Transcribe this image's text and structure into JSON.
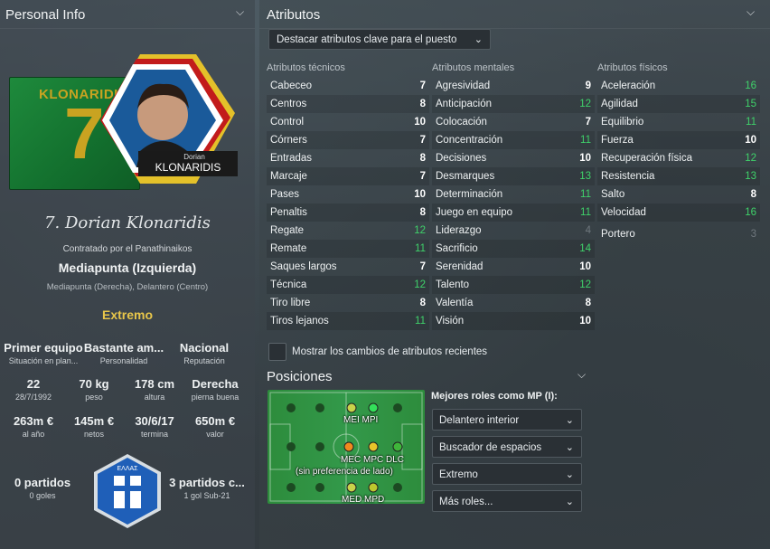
{
  "personal": {
    "title": "Personal Info",
    "card_name": "KLONARIDIS",
    "card_number": "7",
    "badge_first": "Dorian",
    "badge_last": "KLONARIDIS",
    "signature": "7. Dorian Klonaridis",
    "signed_by": "Contratado por el Panathinaikos",
    "position": "Mediapunta (Izquierda)",
    "alt_positions": "Mediapunta (Derecha), Delantero (Centro)",
    "role": "Extremo",
    "stats": [
      {
        "value": "Primer equipo",
        "label": "Situación en plan..."
      },
      {
        "value": "Bastante am...",
        "label": "Personalidad"
      },
      {
        "value": "Nacional",
        "label": "Reputación"
      },
      {
        "value": "22",
        "label": "28/7/1992"
      },
      {
        "value": "70 kg",
        "label": "peso"
      },
      {
        "value": "178 cm",
        "label": "altura"
      },
      {
        "value": "Derecha",
        "label": "pierna buena"
      },
      {
        "value": "263m €",
        "label": "al año"
      },
      {
        "value": "145m €",
        "label": "netos"
      },
      {
        "value": "30/6/17",
        "label": "termina"
      },
      {
        "value": "650m €",
        "label": "valor"
      }
    ],
    "left_apps": {
      "value": "0 partidos",
      "label": "0 goles"
    },
    "right_apps": {
      "value": "3 partidos c...",
      "label": "1 gol Sub-21"
    },
    "flag_text": "ΕΛΛΑΣ"
  },
  "attributes": {
    "title": "Atributos",
    "highlight_dropdown": "Destacar atributos clave para el puesto",
    "technical_header": "Atributos técnicos",
    "mental_header": "Atributos mentales",
    "physical_header": "Atributos físicos",
    "technical": [
      {
        "name": "Cabeceo",
        "value": "7"
      },
      {
        "name": "Centros",
        "value": "8"
      },
      {
        "name": "Control",
        "value": "10"
      },
      {
        "name": "Córners",
        "value": "7"
      },
      {
        "name": "Entradas",
        "value": "8"
      },
      {
        "name": "Marcaje",
        "value": "7"
      },
      {
        "name": "Pases",
        "value": "10"
      },
      {
        "name": "Penaltis",
        "value": "8"
      },
      {
        "name": "Regate",
        "value": "12"
      },
      {
        "name": "Remate",
        "value": "11"
      },
      {
        "name": "Saques largos",
        "value": "7"
      },
      {
        "name": "Técnica",
        "value": "12"
      },
      {
        "name": "Tiro libre",
        "value": "8"
      },
      {
        "name": "Tiros lejanos",
        "value": "11"
      }
    ],
    "mental": [
      {
        "name": "Agresividad",
        "value": "9"
      },
      {
        "name": "Anticipación",
        "value": "12"
      },
      {
        "name": "Colocación",
        "value": "7"
      },
      {
        "name": "Concentración",
        "value": "11"
      },
      {
        "name": "Decisiones",
        "value": "10"
      },
      {
        "name": "Desmarques",
        "value": "13"
      },
      {
        "name": "Determinación",
        "value": "11"
      },
      {
        "name": "Juego en equipo",
        "value": "11"
      },
      {
        "name": "Liderazgo",
        "value": "4"
      },
      {
        "name": "Sacrificio",
        "value": "14"
      },
      {
        "name": "Serenidad",
        "value": "10"
      },
      {
        "name": "Talento",
        "value": "12"
      },
      {
        "name": "Valentía",
        "value": "8"
      },
      {
        "name": "Visión",
        "value": "10"
      }
    ],
    "physical": [
      {
        "name": "Aceleración",
        "value": "16"
      },
      {
        "name": "Agilidad",
        "value": "15"
      },
      {
        "name": "Equilibrio",
        "value": "11"
      },
      {
        "name": "Fuerza",
        "value": "10"
      },
      {
        "name": "Recuperación física",
        "value": "12"
      },
      {
        "name": "Resistencia",
        "value": "13"
      },
      {
        "name": "Salto",
        "value": "8"
      },
      {
        "name": "Velocidad",
        "value": "16"
      }
    ],
    "goalkeeper": {
      "name": "Portero",
      "value": "3"
    },
    "recent_changes_label": "Mostrar los cambios de atributos recientes"
  },
  "positions": {
    "title": "Posiciones",
    "best_roles_header": "Mejores roles como MP (I):",
    "roles": [
      "Delantero interior",
      "Buscador de espacios",
      "Extremo",
      "Más roles..."
    ],
    "pitch_labels": {
      "mei_mpi": "MEI  MPI",
      "mec_mpc_dlc": "MEC MPC DLC",
      "no_pref": "(sin preferencia de lado)",
      "med_mpd": "MED MPD"
    }
  },
  "colors": {
    "white_value": "#ffffff",
    "green_value": "#3fd26a",
    "dim_value": "#6f777d",
    "gold": "#e8c64a"
  }
}
